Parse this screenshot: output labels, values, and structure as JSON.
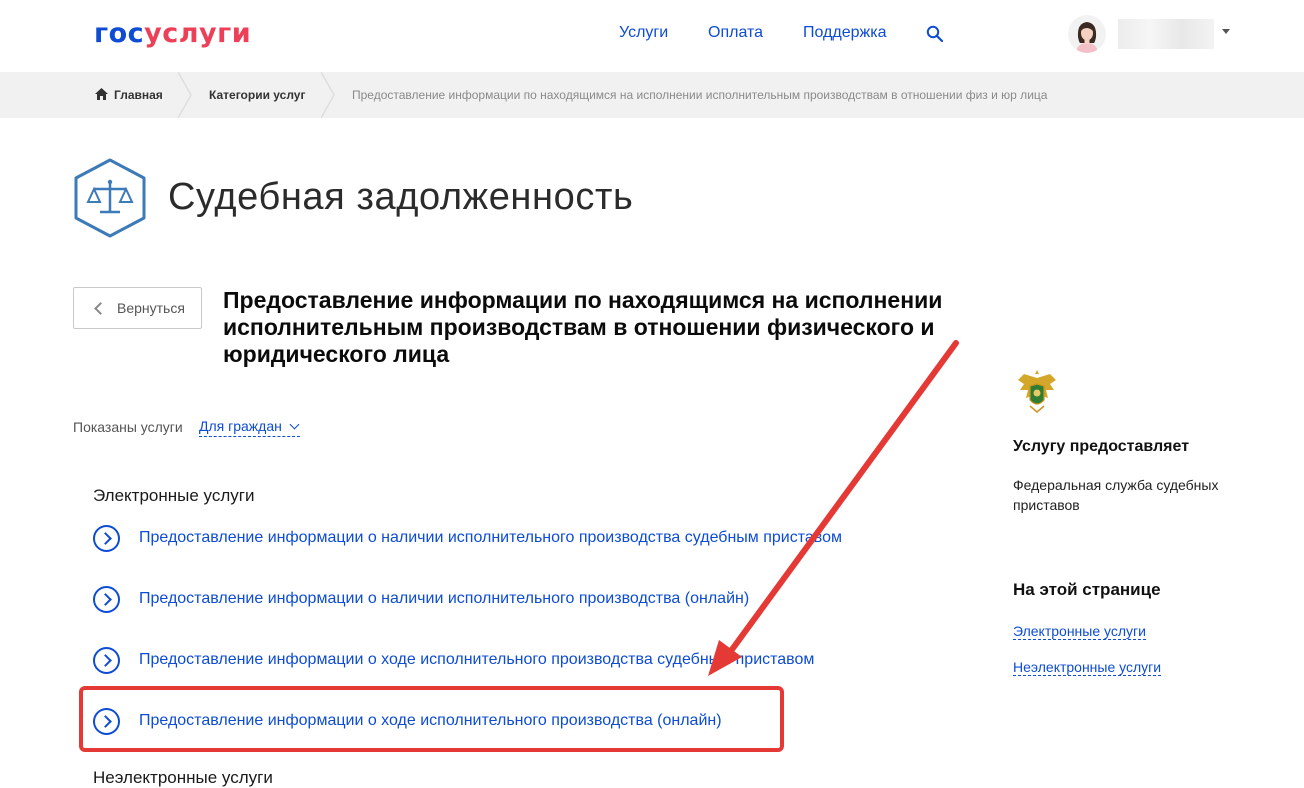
{
  "header": {
    "logo_part1": "гос",
    "logo_part2": "услуги",
    "nav": [
      "Услуги",
      "Оплата",
      "Поддержка"
    ]
  },
  "breadcrumbs": {
    "home": "Главная",
    "categories": "Категории услуг",
    "current": "Предоставление информации по находящимся на исполнении исполнительным производствам в отношении физ и юр лица"
  },
  "page": {
    "title": "Судебная задолженность",
    "back_label": "Вернуться",
    "service_title": "Предоставление информации по находящимся на исполнении исполнительным производствам в отношении физического и юридического лица",
    "filter_label": "Показаны услуги",
    "filter_value": "Для граждан"
  },
  "electronic": {
    "heading": "Электронные услуги",
    "items": [
      "Предоставление информации о наличии исполнительного производства судебным приставом",
      "Предоставление информации о наличии исполнительного производства (онлайн)",
      "Предоставление информации о ходе исполнительного производства судебным приставом",
      "Предоставление информации о ходе исполнительного производства (онлайн)"
    ]
  },
  "non_electronic": {
    "heading": "Неэлектронные услуги"
  },
  "sidebar": {
    "provider_heading": "Услугу предоставляет",
    "provider_name": "Федеральная служба судебных приставов",
    "on_page_heading": "На этой странице",
    "links": [
      "Электронные услуги",
      "Неэлектронные услуги"
    ]
  },
  "colors": {
    "brand_blue": "#0d4cd3",
    "brand_red": "#ee3f58",
    "annotation_red": "#e53935",
    "hex_blue": "#3d7ab8"
  }
}
